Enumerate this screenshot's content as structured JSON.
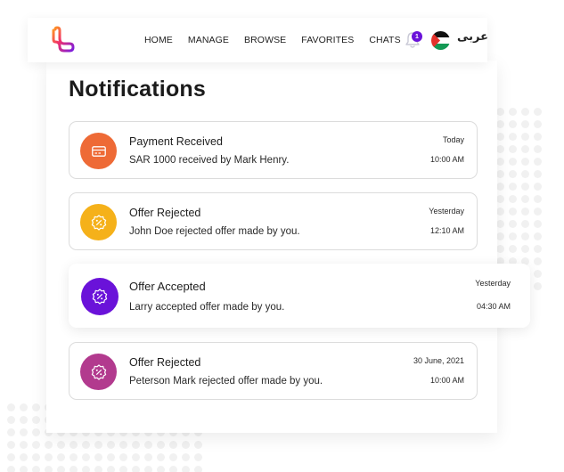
{
  "navbar": {
    "logo": "app-logo",
    "links": [
      "HOME",
      "MANAGE",
      "BROWSE",
      "FAVORITES",
      "CHATS"
    ],
    "notification_count": "1",
    "language_label": "عربى",
    "flag": "palestine-flag"
  },
  "page": {
    "title": "Notifications"
  },
  "notifications": [
    {
      "title": "Payment Received",
      "description": "SAR 1000 received by Mark Henry.",
      "date": "Today",
      "time": "10:00 AM",
      "icon": "credit-card-icon",
      "color": "#ee6a36"
    },
    {
      "title": "Offer Rejected",
      "description": "John Doe rejected offer made by you.",
      "date": "Yesterday",
      "time": "12:10 AM",
      "icon": "discount-badge-icon",
      "color": "#f5b11a"
    },
    {
      "title": "Offer Accepted",
      "description": "Larry accepted offer made by you.",
      "date": "Yesterday",
      "time": "04:30 AM",
      "icon": "discount-badge-icon",
      "color": "#6a12d9"
    },
    {
      "title": "Offer Rejected",
      "description": "Peterson Mark rejected offer made by you.",
      "date": "30 June, 2021",
      "time": "10:00 AM",
      "icon": "discount-badge-icon",
      "color": "#b23a8e"
    }
  ]
}
